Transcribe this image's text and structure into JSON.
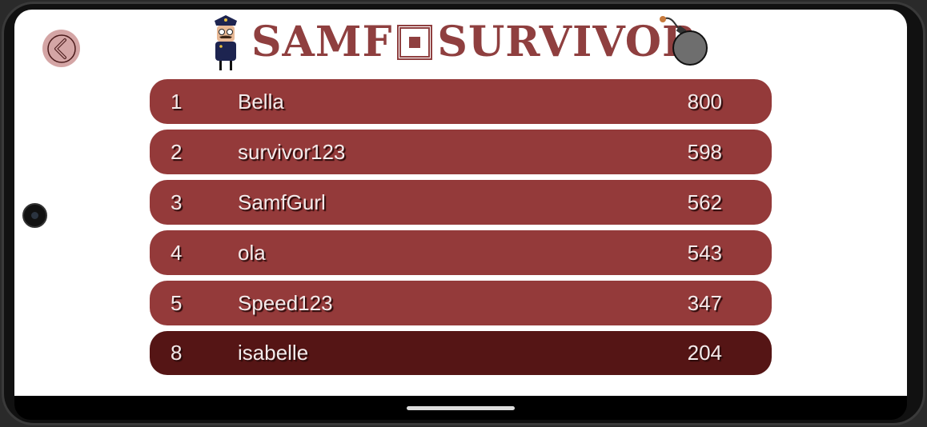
{
  "header": {
    "title_left": "SAMF",
    "title_right": "SURVIVOR",
    "back_label": "back"
  },
  "leaderboard": [
    {
      "rank": "1",
      "name": "Bella",
      "score": "800"
    },
    {
      "rank": "2",
      "name": "survivor123",
      "score": "598"
    },
    {
      "rank": "3",
      "name": "SamfGurl",
      "score": "562"
    },
    {
      "rank": "4",
      "name": "ola",
      "score": "543"
    },
    {
      "rank": "5",
      "name": "Speed123",
      "score": "347"
    },
    {
      "rank": "8",
      "name": "isabelle",
      "score": "204",
      "current_user": true
    }
  ],
  "colors": {
    "row": "#943a3a",
    "current_row": "#551515",
    "title": "#8f3f3f",
    "back": "#d4a5a5"
  }
}
